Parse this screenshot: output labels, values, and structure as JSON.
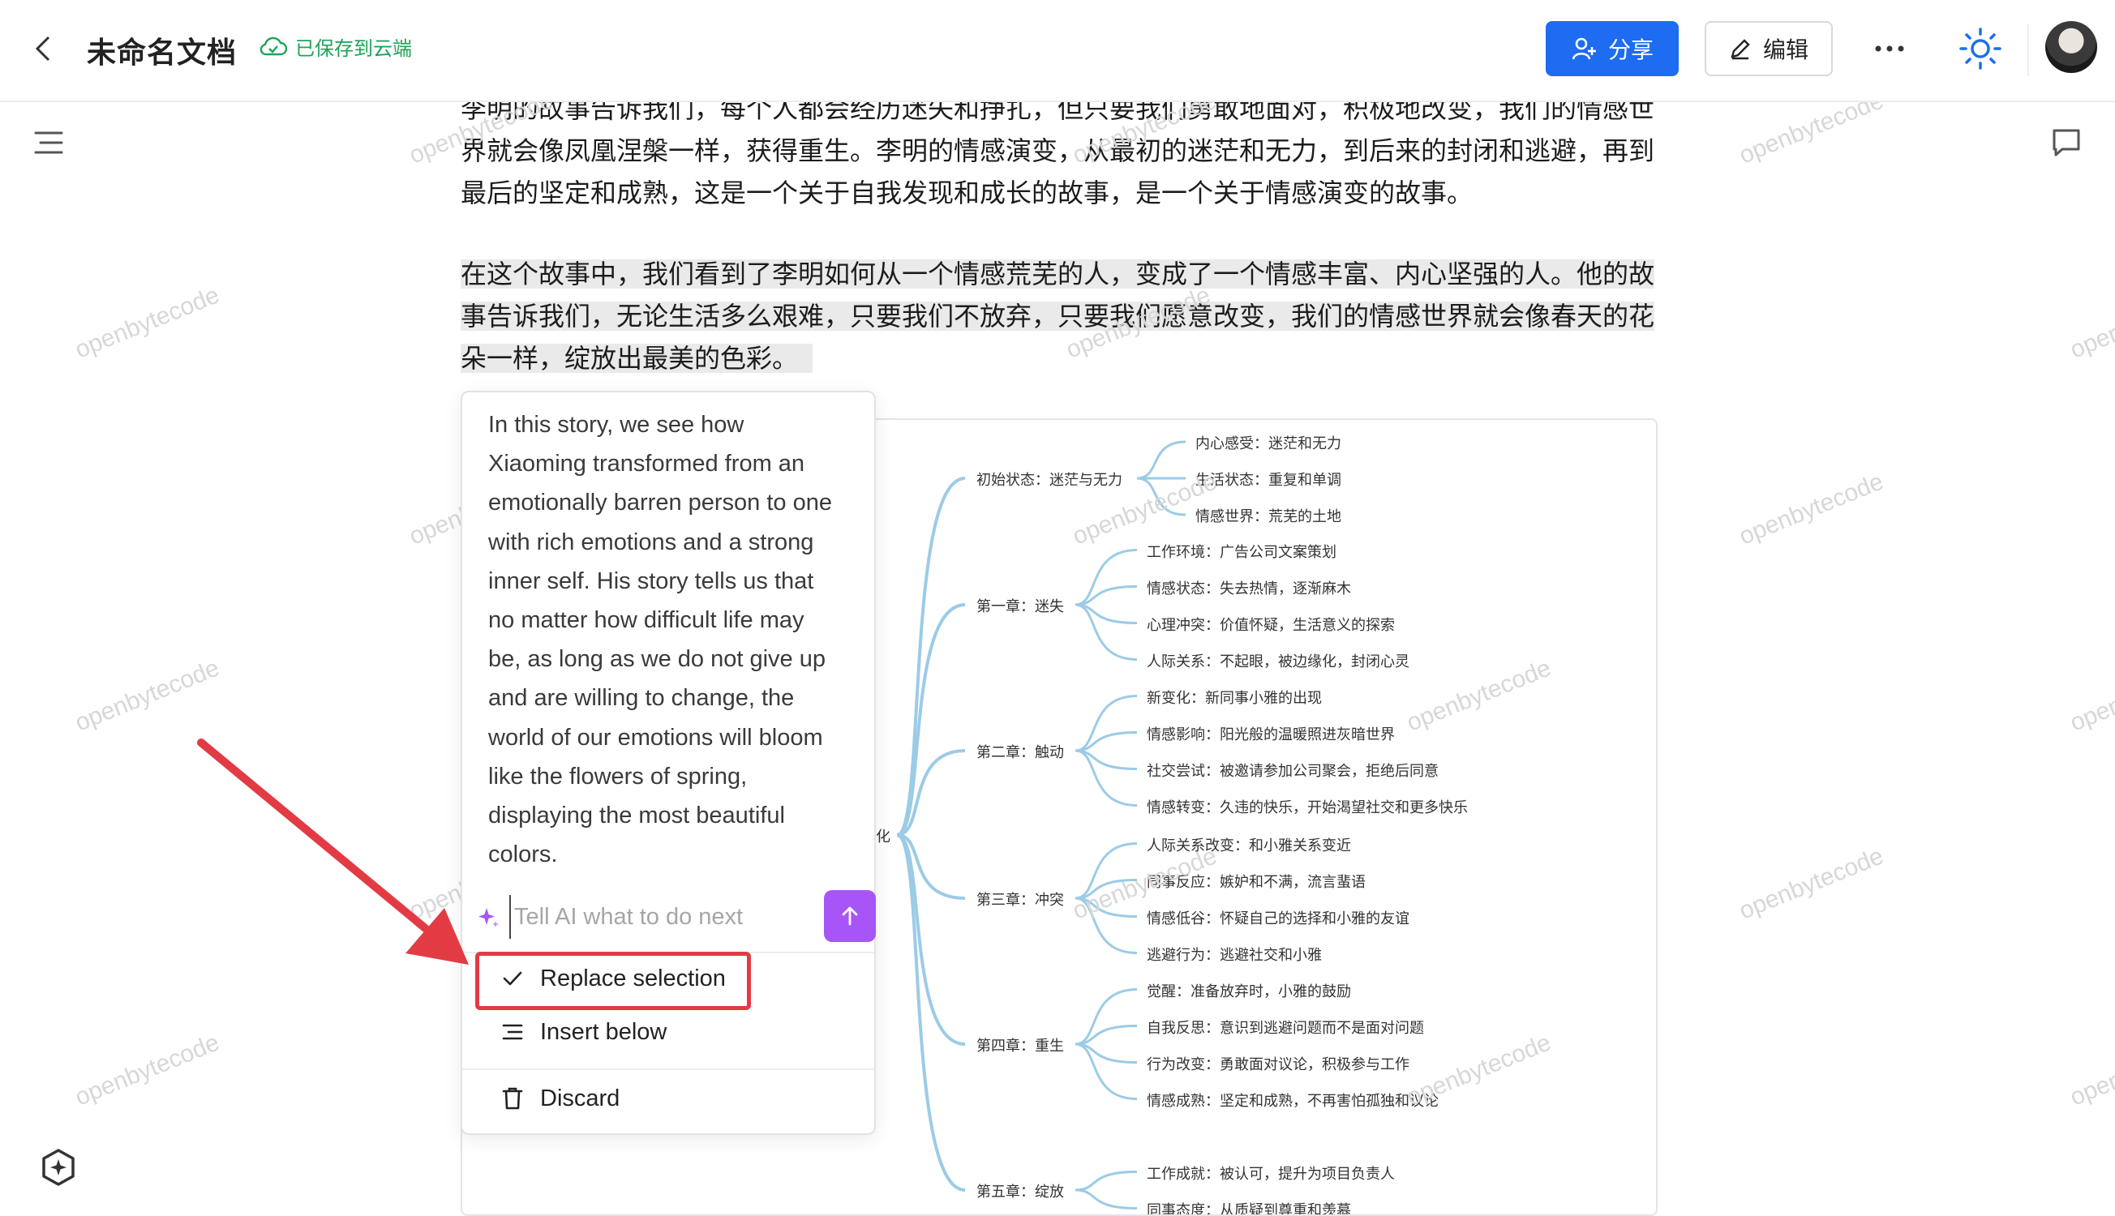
{
  "header": {
    "doc_title": "未命名文档",
    "saved_status": "已保存到云端",
    "share_label": "分享",
    "edit_label": "编辑"
  },
  "document": {
    "para1_lines": [
      "李明的故事告诉我们，每个人都会经历迷失和挣扎，但只要我们勇敢地面对，积极地改变，我们的情感世",
      "界就会像凤凰涅槃一样，获得重生。李明的情感演变，从最初的迷茫和无力，到后来的封闭和逃避，再到",
      "最后的坚定和成熟，这是一个关于自我发现和成长的故事，是一个关于情感演变的故事。"
    ],
    "para2_lines": [
      "在这个故事中，我们看到了李明如何从一个情感荒芜的人，变成了一个情感丰富、内心坚强的人。他的故",
      "事告诉我们，无论生活多么艰难，只要我们不放弃，只要我们愿意改变，我们的情感世界就会像春天的花",
      "朵一样，绽放出最美的色彩。"
    ]
  },
  "mindmap": {
    "root_fragment": "化",
    "branches": [
      {
        "label": "初始状态：迷茫与无力",
        "children": [
          "内心感受：迷茫和无力",
          "生活状态：重复和单调",
          "情感世界：荒芜的土地"
        ]
      },
      {
        "label": "第一章：迷失",
        "children": [
          "工作环境：广告公司文案策划",
          "情感状态：失去热情，逐渐麻木",
          "心理冲突：价值怀疑，生活意义的探索",
          "人际关系：不起眼，被边缘化，封闭心灵"
        ]
      },
      {
        "label": "第二章：触动",
        "children": [
          "新变化：新同事小雅的出现",
          "情感影响：阳光般的温暖照进灰暗世界",
          "社交尝试：被邀请参加公司聚会，拒绝后同意",
          "情感转变：久违的快乐，开始渴望社交和更多快乐"
        ]
      },
      {
        "label": "第三章：冲突",
        "children": [
          "人际关系改变：和小雅关系变近",
          "同事反应：嫉妒和不满，流言蜚语",
          "情感低谷：怀疑自己的选择和小雅的友谊",
          "逃避行为：逃避社交和小雅"
        ]
      },
      {
        "label": "第四章：重生",
        "children": [
          "觉醒：准备放弃时，小雅的鼓励",
          "自我反思：意识到逃避问题而不是面对问题",
          "行为改变：勇敢面对议论，积极参与工作",
          "情感成熟：坚定和成熟，不再害怕孤独和议论"
        ]
      },
      {
        "label": "第五章：绽放",
        "children": [
          "工作成就：被认可，提升为项目负责人",
          "同事态度：从质疑到尊重和羡慕"
        ]
      }
    ]
  },
  "ai_popup": {
    "result_lines": [
      "In this story, we see how",
      "Xiaoming transformed from an",
      "emotionally barren person to one",
      "with rich emotions and a strong",
      "inner self. His story tells us that",
      "no matter how difficult life may",
      "be, as long as we do not give up",
      "and are willing to change, the",
      "world of our emotions will bloom",
      "like the flowers of spring,",
      "displaying the most beautiful",
      "colors."
    ],
    "input_placeholder": "Tell AI what to do next",
    "replace_label": "Replace selection",
    "insert_label": "Insert below",
    "discard_label": "Discard"
  },
  "watermark_text": "openbytecode",
  "colors": {
    "share_blue": "#1d6cf2",
    "saved_green": "#1fa35a",
    "send_purple": "#a855f7",
    "highlight_red": "#e23b44",
    "mindmap_line": "#9ccbe6"
  }
}
